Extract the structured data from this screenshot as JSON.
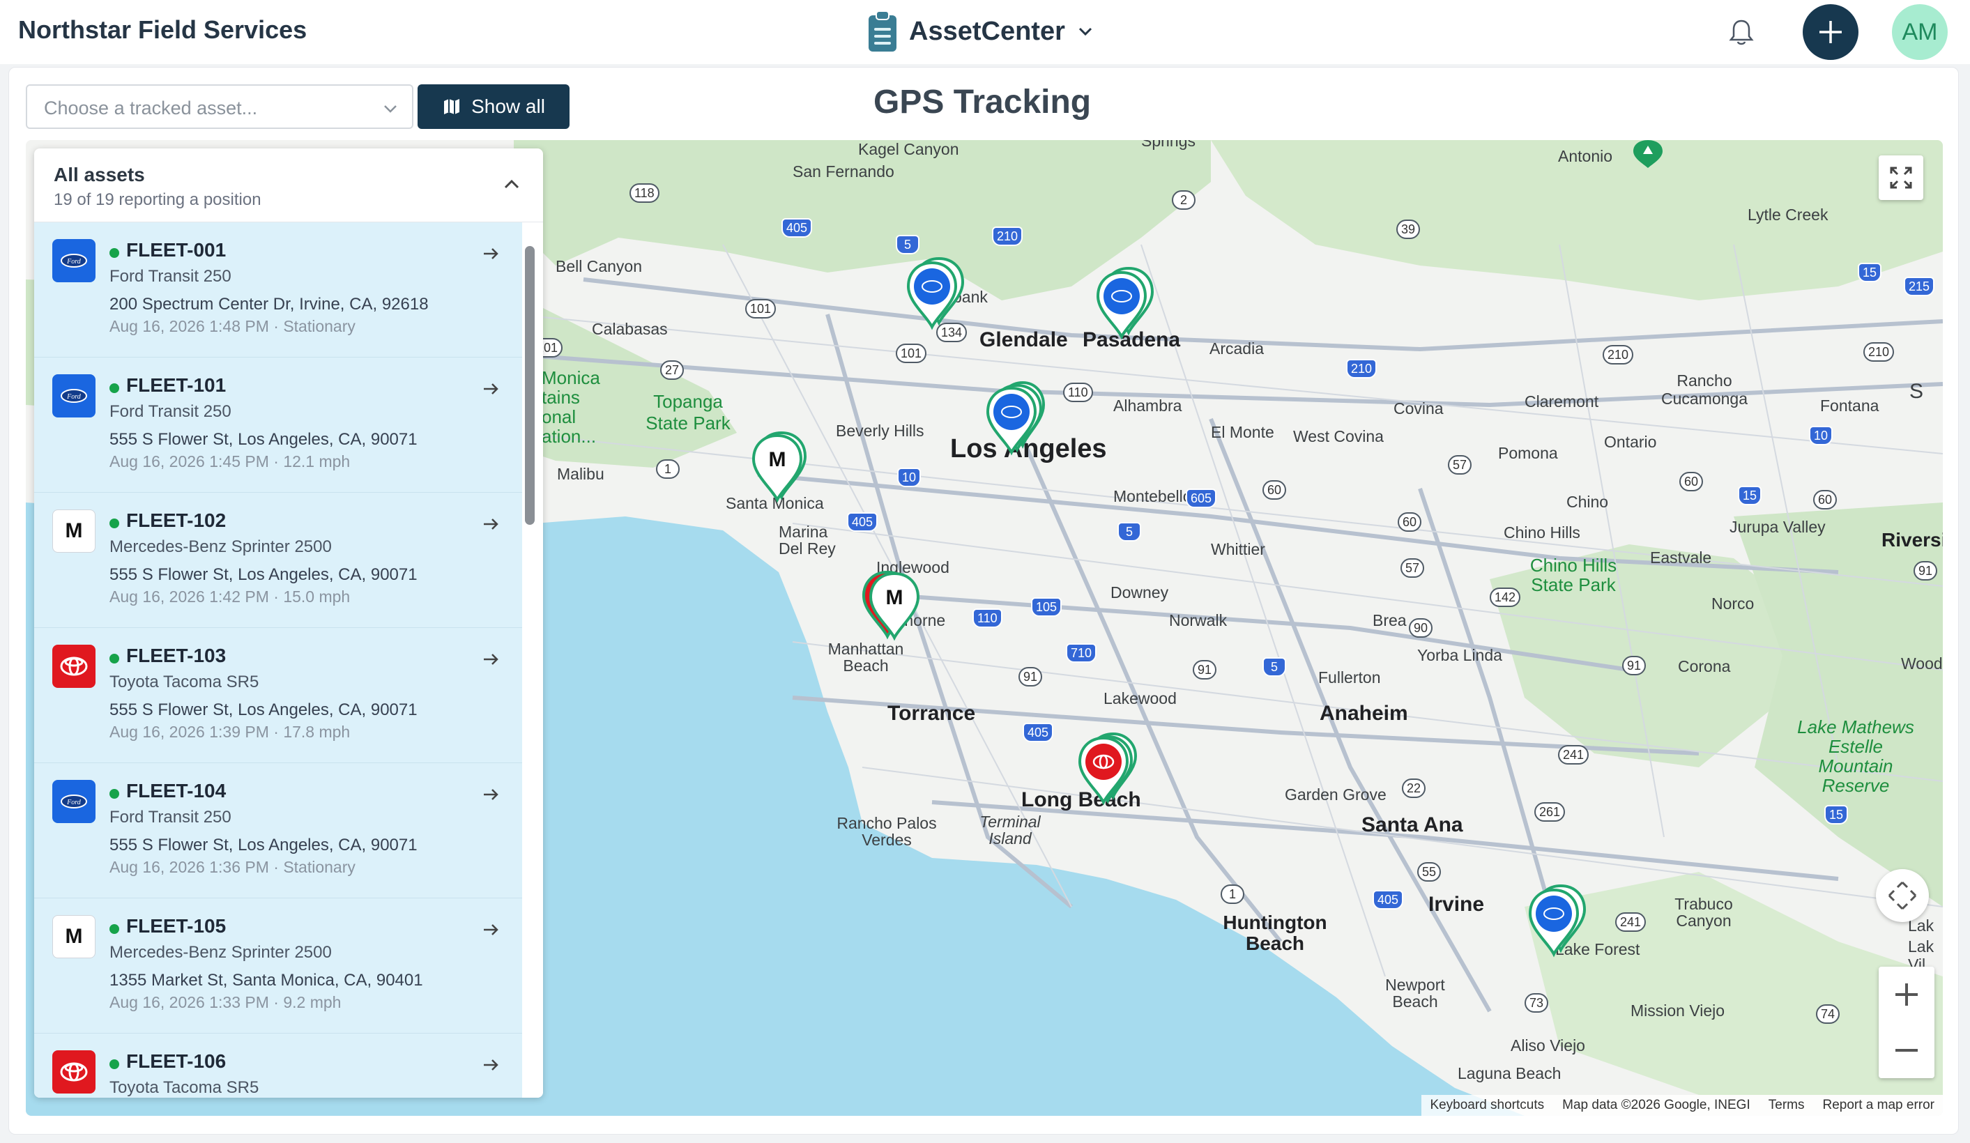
{
  "header": {
    "brand": "Northstar Field Services",
    "app_name": "AssetCenter",
    "avatar_initials": "AM"
  },
  "toolbar": {
    "asset_select_placeholder": "Choose a tracked asset...",
    "show_all_label": "Show all",
    "page_title": "GPS Tracking"
  },
  "panel": {
    "title": "All assets",
    "subtitle": "19 of 19 reporting a position",
    "items": [
      {
        "id": "FLEET-001",
        "model": "Ford Transit 250",
        "address": "200 Spectrum Center Dr, Irvine, CA, 92618",
        "status": "Aug 16, 2026 1:48 PM · Stationary",
        "brand": "ford"
      },
      {
        "id": "FLEET-101",
        "model": "Ford Transit 250",
        "address": "555 S Flower St, Los Angeles, CA, 90071",
        "status": "Aug 16, 2026 1:45 PM · 12.1 mph",
        "brand": "ford"
      },
      {
        "id": "FLEET-102",
        "model": "Mercedes-Benz Sprinter 2500",
        "address": "555 S Flower St, Los Angeles, CA, 90071",
        "status": "Aug 16, 2026 1:42 PM · 15.0 mph",
        "brand": "mercedes"
      },
      {
        "id": "FLEET-103",
        "model": "Toyota Tacoma SR5",
        "address": "555 S Flower St, Los Angeles, CA, 90071",
        "status": "Aug 16, 2026 1:39 PM · 17.8 mph",
        "brand": "toyota"
      },
      {
        "id": "FLEET-104",
        "model": "Ford Transit 250",
        "address": "555 S Flower St, Los Angeles, CA, 90071",
        "status": "Aug 16, 2026 1:36 PM · Stationary",
        "brand": "ford"
      },
      {
        "id": "FLEET-105",
        "model": "Mercedes-Benz Sprinter 2500",
        "address": "1355 Market St, Santa Monica, CA, 90401",
        "status": "Aug 16, 2026 1:33 PM · 9.2 mph",
        "brand": "mercedes"
      },
      {
        "id": "FLEET-106",
        "model": "Toyota Tacoma SR5",
        "address": "",
        "status": "",
        "brand": "toyota"
      }
    ]
  },
  "map": {
    "places": {
      "kagel": "Kagel Canyon",
      "sanfernando": "San Fernando",
      "bellcanyon": "Bell Canyon",
      "calabasas": "Calabasas",
      "monica1": "Monica",
      "monica2": "tains",
      "monica3": "onal",
      "monica4": "ation...",
      "topanga": "Topanga State Park",
      "malibu": "Malibu",
      "beverly": "Beverly Hills",
      "losangeles": "Los Angeles",
      "glendale": "Glendale",
      "pasadena": "Pasadena",
      "burbank": "bank",
      "arcadia": "Arcadia",
      "alhambra": "Alhambra",
      "elmonte": "El Monte",
      "westcovina": "West Covina",
      "covina": "Covina",
      "claremont": "Claremont",
      "rancho": "Rancho Cucamonga",
      "fontana": "Fontana",
      "ontario": "Ontario",
      "pomona": "Pomona",
      "chino": "Chino",
      "chinohills": "Chino Hills",
      "chinohillspark": "Chino Hills State Park",
      "jurupa": "Jurupa Valley",
      "riverside": "Riversid",
      "eastvale": "Eastvale",
      "norco": "Norco",
      "corona": "Corona",
      "santamonica": "Santa Monica",
      "marina": "Marina Del Rey",
      "inglewood": "Inglewood",
      "hawthorne": "thorne",
      "manhattan": "Manhattan Beach",
      "montebello": "Montebello",
      "whittier": "Whittier",
      "downey": "Downey",
      "norwalk": "Norwalk",
      "brea": "Brea",
      "yorba": "Yorba Linda",
      "fullerton": "Fullerton",
      "anaheim": "Anaheim",
      "lakewood": "Lakewood",
      "torrance": "Torrance",
      "longbeach": "Long Beach",
      "rpv": "Rancho Palos Verdes",
      "terminal": "Terminal Island",
      "gardengrove": "Garden Grove",
      "santaana": "Santa Ana",
      "huntington": "Huntington Beach",
      "irvine": "Irvine",
      "newport": "Newport Beach",
      "lakeforest": "Lake Forest",
      "missionviejo": "Mission Viejo",
      "alisoviejo": "Aliso Viejo",
      "lagunabeach": "Laguna Beach",
      "trabuco": "Trabuco Canyon",
      "lakemathews": "Lake Mathews Estelle Mountain Reserve",
      "lytle": "Lytle Creek",
      "antonio": "Antonio",
      "woodc": "Wood",
      "springs": "Springs",
      "lak1": "Lak",
      "lak2": "Lak",
      "lak3": "Vil",
      "s": "S"
    },
    "attribution": {
      "shortcuts": "Keyboard shortcuts",
      "data": "Map data ©2026 Google, INEGI",
      "terms": "Terms",
      "report": "Report a map error"
    }
  }
}
